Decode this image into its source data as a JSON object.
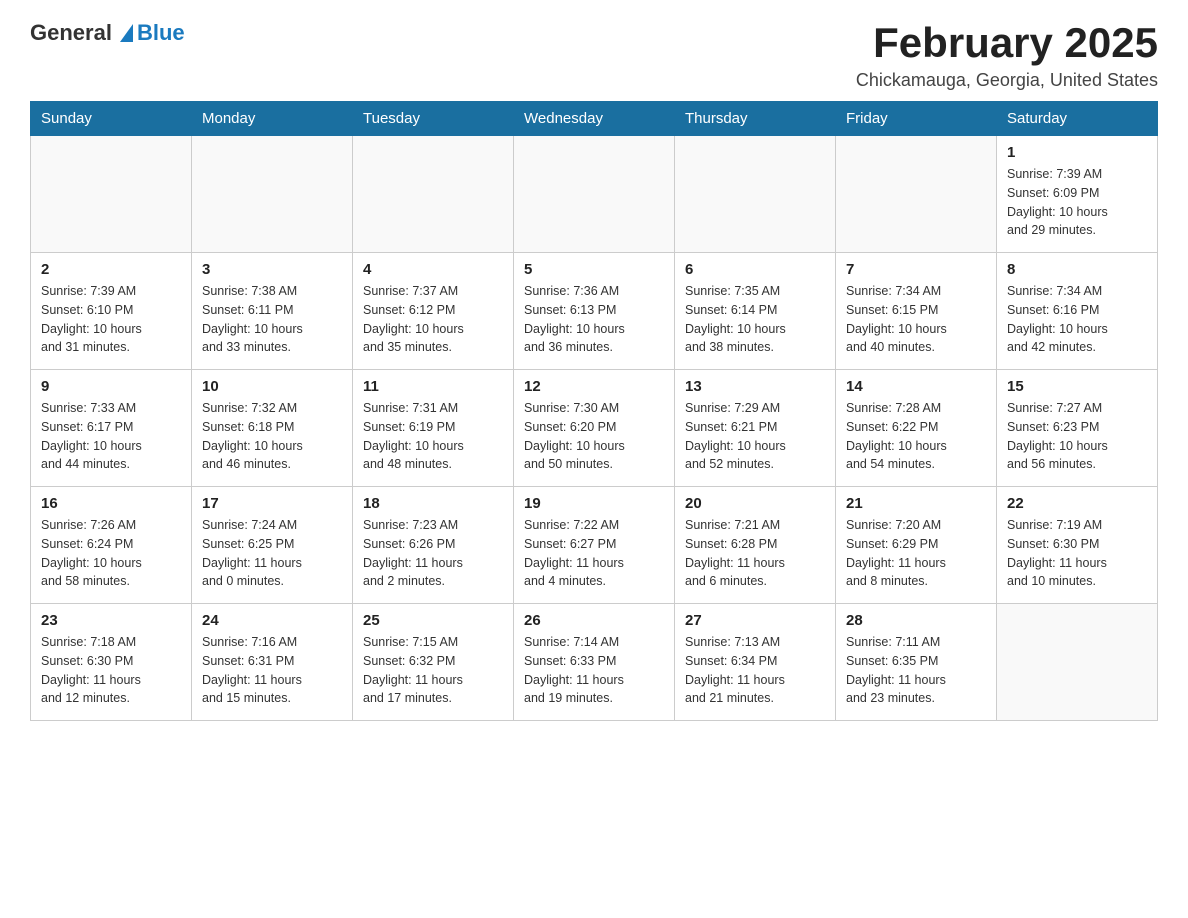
{
  "header": {
    "logo": {
      "text_general": "General",
      "text_blue": "Blue"
    },
    "title": "February 2025",
    "subtitle": "Chickamauga, Georgia, United States"
  },
  "weekdays": [
    "Sunday",
    "Monday",
    "Tuesday",
    "Wednesday",
    "Thursday",
    "Friday",
    "Saturday"
  ],
  "weeks": [
    [
      {
        "day": "",
        "info": ""
      },
      {
        "day": "",
        "info": ""
      },
      {
        "day": "",
        "info": ""
      },
      {
        "day": "",
        "info": ""
      },
      {
        "day": "",
        "info": ""
      },
      {
        "day": "",
        "info": ""
      },
      {
        "day": "1",
        "info": "Sunrise: 7:39 AM\nSunset: 6:09 PM\nDaylight: 10 hours\nand 29 minutes."
      }
    ],
    [
      {
        "day": "2",
        "info": "Sunrise: 7:39 AM\nSunset: 6:10 PM\nDaylight: 10 hours\nand 31 minutes."
      },
      {
        "day": "3",
        "info": "Sunrise: 7:38 AM\nSunset: 6:11 PM\nDaylight: 10 hours\nand 33 minutes."
      },
      {
        "day": "4",
        "info": "Sunrise: 7:37 AM\nSunset: 6:12 PM\nDaylight: 10 hours\nand 35 minutes."
      },
      {
        "day": "5",
        "info": "Sunrise: 7:36 AM\nSunset: 6:13 PM\nDaylight: 10 hours\nand 36 minutes."
      },
      {
        "day": "6",
        "info": "Sunrise: 7:35 AM\nSunset: 6:14 PM\nDaylight: 10 hours\nand 38 minutes."
      },
      {
        "day": "7",
        "info": "Sunrise: 7:34 AM\nSunset: 6:15 PM\nDaylight: 10 hours\nand 40 minutes."
      },
      {
        "day": "8",
        "info": "Sunrise: 7:34 AM\nSunset: 6:16 PM\nDaylight: 10 hours\nand 42 minutes."
      }
    ],
    [
      {
        "day": "9",
        "info": "Sunrise: 7:33 AM\nSunset: 6:17 PM\nDaylight: 10 hours\nand 44 minutes."
      },
      {
        "day": "10",
        "info": "Sunrise: 7:32 AM\nSunset: 6:18 PM\nDaylight: 10 hours\nand 46 minutes."
      },
      {
        "day": "11",
        "info": "Sunrise: 7:31 AM\nSunset: 6:19 PM\nDaylight: 10 hours\nand 48 minutes."
      },
      {
        "day": "12",
        "info": "Sunrise: 7:30 AM\nSunset: 6:20 PM\nDaylight: 10 hours\nand 50 minutes."
      },
      {
        "day": "13",
        "info": "Sunrise: 7:29 AM\nSunset: 6:21 PM\nDaylight: 10 hours\nand 52 minutes."
      },
      {
        "day": "14",
        "info": "Sunrise: 7:28 AM\nSunset: 6:22 PM\nDaylight: 10 hours\nand 54 minutes."
      },
      {
        "day": "15",
        "info": "Sunrise: 7:27 AM\nSunset: 6:23 PM\nDaylight: 10 hours\nand 56 minutes."
      }
    ],
    [
      {
        "day": "16",
        "info": "Sunrise: 7:26 AM\nSunset: 6:24 PM\nDaylight: 10 hours\nand 58 minutes."
      },
      {
        "day": "17",
        "info": "Sunrise: 7:24 AM\nSunset: 6:25 PM\nDaylight: 11 hours\nand 0 minutes."
      },
      {
        "day": "18",
        "info": "Sunrise: 7:23 AM\nSunset: 6:26 PM\nDaylight: 11 hours\nand 2 minutes."
      },
      {
        "day": "19",
        "info": "Sunrise: 7:22 AM\nSunset: 6:27 PM\nDaylight: 11 hours\nand 4 minutes."
      },
      {
        "day": "20",
        "info": "Sunrise: 7:21 AM\nSunset: 6:28 PM\nDaylight: 11 hours\nand 6 minutes."
      },
      {
        "day": "21",
        "info": "Sunrise: 7:20 AM\nSunset: 6:29 PM\nDaylight: 11 hours\nand 8 minutes."
      },
      {
        "day": "22",
        "info": "Sunrise: 7:19 AM\nSunset: 6:30 PM\nDaylight: 11 hours\nand 10 minutes."
      }
    ],
    [
      {
        "day": "23",
        "info": "Sunrise: 7:18 AM\nSunset: 6:30 PM\nDaylight: 11 hours\nand 12 minutes."
      },
      {
        "day": "24",
        "info": "Sunrise: 7:16 AM\nSunset: 6:31 PM\nDaylight: 11 hours\nand 15 minutes."
      },
      {
        "day": "25",
        "info": "Sunrise: 7:15 AM\nSunset: 6:32 PM\nDaylight: 11 hours\nand 17 minutes."
      },
      {
        "day": "26",
        "info": "Sunrise: 7:14 AM\nSunset: 6:33 PM\nDaylight: 11 hours\nand 19 minutes."
      },
      {
        "day": "27",
        "info": "Sunrise: 7:13 AM\nSunset: 6:34 PM\nDaylight: 11 hours\nand 21 minutes."
      },
      {
        "day": "28",
        "info": "Sunrise: 7:11 AM\nSunset: 6:35 PM\nDaylight: 11 hours\nand 23 minutes."
      },
      {
        "day": "",
        "info": ""
      }
    ]
  ]
}
